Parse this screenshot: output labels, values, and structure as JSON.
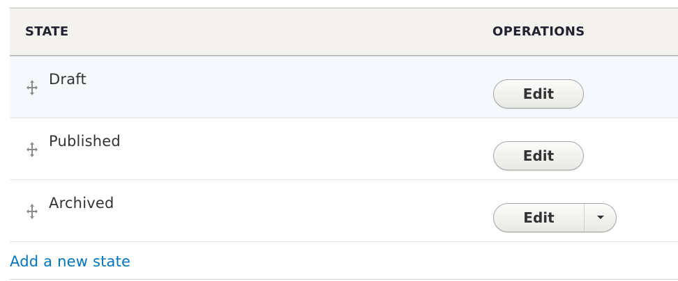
{
  "table": {
    "headers": {
      "state": "STATE",
      "operations": "OPERATIONS"
    },
    "rows": [
      {
        "label": "Draft",
        "button": "Edit",
        "has_dropdown": false,
        "icon": "drag-handle-icon"
      },
      {
        "label": "Published",
        "button": "Edit",
        "has_dropdown": false,
        "icon": "drag-handle-icon"
      },
      {
        "label": "Archived",
        "button": "Edit",
        "has_dropdown": true,
        "icon": "drag-handle-icon"
      }
    ]
  },
  "footer": {
    "add_link": "Add a new state"
  },
  "colors": {
    "header_bg": "#f3f2ee",
    "highlight_row_bg": "#f5f9fd",
    "link": "#0074bd",
    "text": "#333333"
  }
}
